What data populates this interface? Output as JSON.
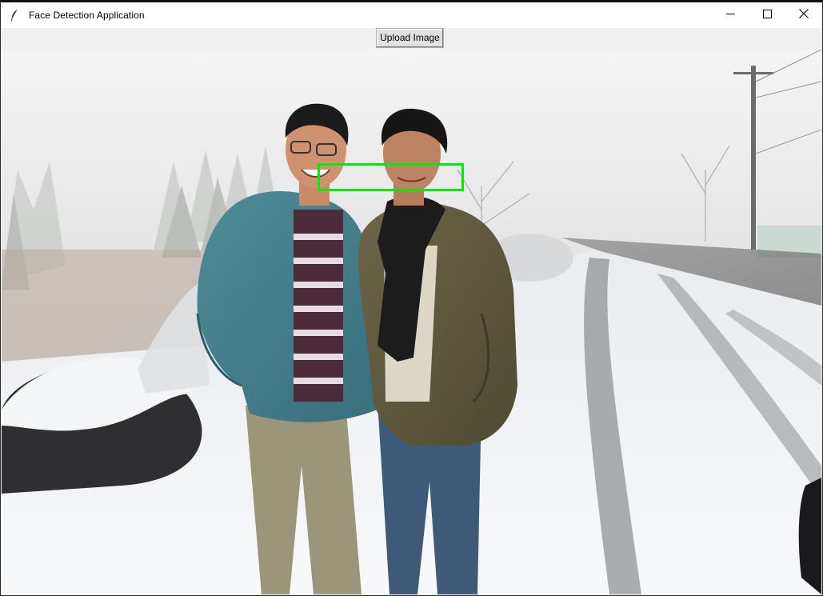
{
  "window": {
    "title": "Face Detection Application",
    "icons": {
      "app": "feather-icon",
      "minimize": "minimize-icon",
      "maximize": "maximize-icon",
      "close": "close-icon"
    }
  },
  "toolbar": {
    "upload_label": "Upload Image"
  },
  "image": {
    "description_icon": "photo-two-men-snowy-road",
    "detections": [
      {
        "label": "face",
        "color": "#00ee00"
      }
    ]
  },
  "colors": {
    "titlebar": "#ffffff",
    "window_bg": "#f0f0f0",
    "detection_box": "#00ee00",
    "button_bg": "#e1e1e1"
  }
}
